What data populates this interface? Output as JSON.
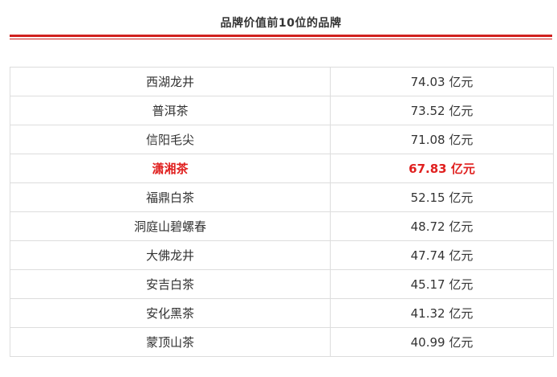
{
  "title": "品牌价值前10位的品牌",
  "colors": {
    "accent": "#d0201e",
    "highlight_text": "#e0201f",
    "border": "#dddddd"
  },
  "rows": [
    {
      "brand": "西湖龙井",
      "value": "74.03 亿元",
      "highlight": false
    },
    {
      "brand": "普洱茶",
      "value": "73.52 亿元",
      "highlight": false
    },
    {
      "brand": "信阳毛尖",
      "value": "71.08 亿元",
      "highlight": false
    },
    {
      "brand": "潇湘茶",
      "value": "67.83 亿元",
      "highlight": true
    },
    {
      "brand": "福鼎白茶",
      "value": "52.15 亿元",
      "highlight": false
    },
    {
      "brand": "洞庭山碧螺春",
      "value": "48.72 亿元",
      "highlight": false
    },
    {
      "brand": "大佛龙井",
      "value": "47.74 亿元",
      "highlight": false
    },
    {
      "brand": "安吉白茶",
      "value": "45.17 亿元",
      "highlight": false
    },
    {
      "brand": "安化黑茶",
      "value": "41.32 亿元",
      "highlight": false
    },
    {
      "brand": "蒙顶山茶",
      "value": "40.99 亿元",
      "highlight": false
    }
  ]
}
